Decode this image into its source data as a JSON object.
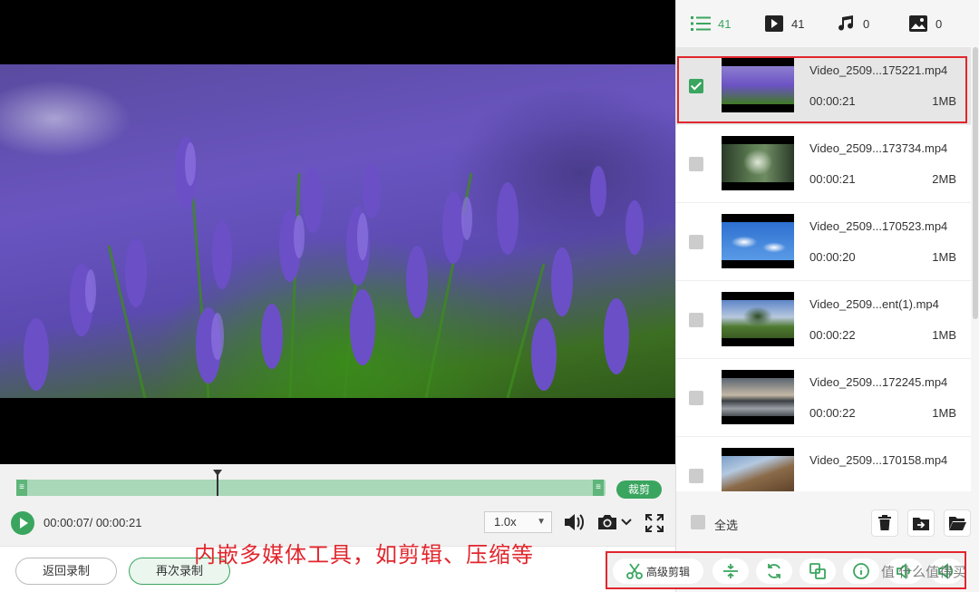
{
  "player": {
    "current_time": "00:00:07/ 00:00:21",
    "speed": "1.0x",
    "trim_label": "裁剪",
    "playhead_fraction": 0.34
  },
  "bottom": {
    "back_label": "返回录制",
    "again_label": "再次录制"
  },
  "tabs": [
    {
      "icon": "list-icon",
      "count": "41"
    },
    {
      "icon": "video-icon",
      "count": "41"
    },
    {
      "icon": "music-icon",
      "count": "0"
    },
    {
      "icon": "image-icon",
      "count": "0"
    }
  ],
  "files": [
    {
      "name": "Video_2509...175221.mp4",
      "duration": "00:00:21",
      "size": "1MB",
      "checked": true
    },
    {
      "name": "Video_2509...173734.mp4",
      "duration": "00:00:21",
      "size": "2MB",
      "checked": false
    },
    {
      "name": "Video_2509...170523.mp4",
      "duration": "00:00:20",
      "size": "1MB",
      "checked": false
    },
    {
      "name": "Video_2509...ent(1).mp4",
      "duration": "00:00:22",
      "size": "1MB",
      "checked": false
    },
    {
      "name": "Video_2509...172245.mp4",
      "duration": "00:00:22",
      "size": "1MB",
      "checked": false
    },
    {
      "name": "Video_2509...170158.mp4",
      "duration": "",
      "size": "",
      "checked": false
    }
  ],
  "panel_footer": {
    "select_all_label": "全选"
  },
  "tools": {
    "advanced_edit_label": "高级剪辑"
  },
  "annotation": "内嵌多媒体工具，如剪辑、压缩等",
  "watermark": "值 什么值得买",
  "colors": {
    "accent": "#3aa55f",
    "highlight": "#e1262d"
  }
}
